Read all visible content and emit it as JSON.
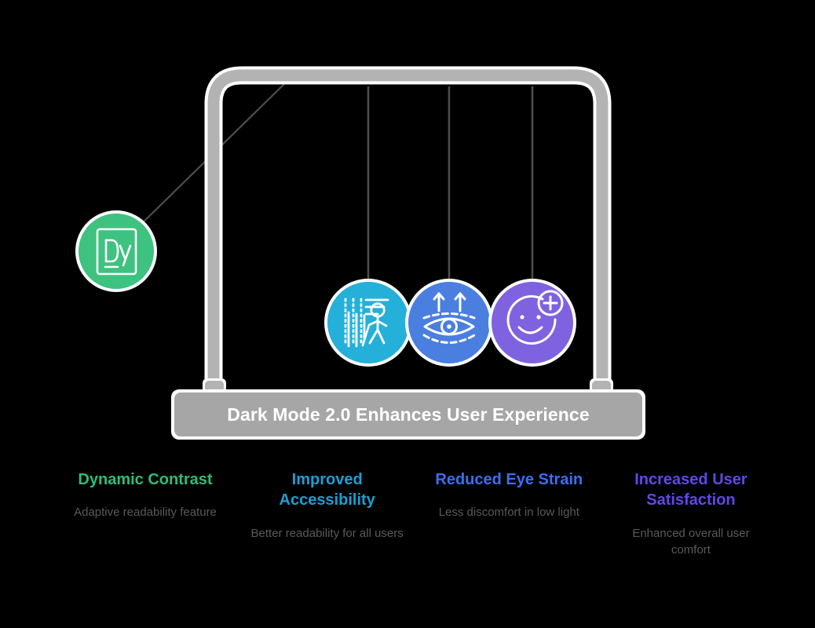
{
  "banner": {
    "title": "Dark Mode 2.0 Enhances User Experience",
    "plate_color": "#a6a6a6",
    "frame_color": "#b3b3b3",
    "string_color": "#4d4d4d",
    "background": "#000000"
  },
  "balls": [
    {
      "id": "dynamic-contrast",
      "icon": "document-dy-icon",
      "icon_text": "Dy",
      "color": "#3ec27f",
      "state": "swung-left"
    },
    {
      "id": "improved-accessibility",
      "icon": "accessibility-walking-cane-icon",
      "color": "#24b0d8",
      "state": "hanging"
    },
    {
      "id": "reduced-eye-strain",
      "icon": "eye-up-arrows-icon",
      "color": "#4a7fe0",
      "state": "hanging"
    },
    {
      "id": "increased-user-satisfaction",
      "icon": "smiley-plus-icon",
      "color": "#7f62e0",
      "state": "hanging"
    }
  ],
  "legend": [
    {
      "title": "Dynamic Contrast",
      "description": "Adaptive readability feature",
      "color": "#2ebd76"
    },
    {
      "title": "Improved Accessibility",
      "description": "Better readability for all users",
      "color": "#1a9fd4"
    },
    {
      "title": "Reduced Eye Strain",
      "description": "Less discomfort in low light",
      "color": "#3a6ff0"
    },
    {
      "title": "Increased User Satisfaction",
      "description": "Enhanced overall user comfort",
      "color": "#6246ea"
    }
  ]
}
